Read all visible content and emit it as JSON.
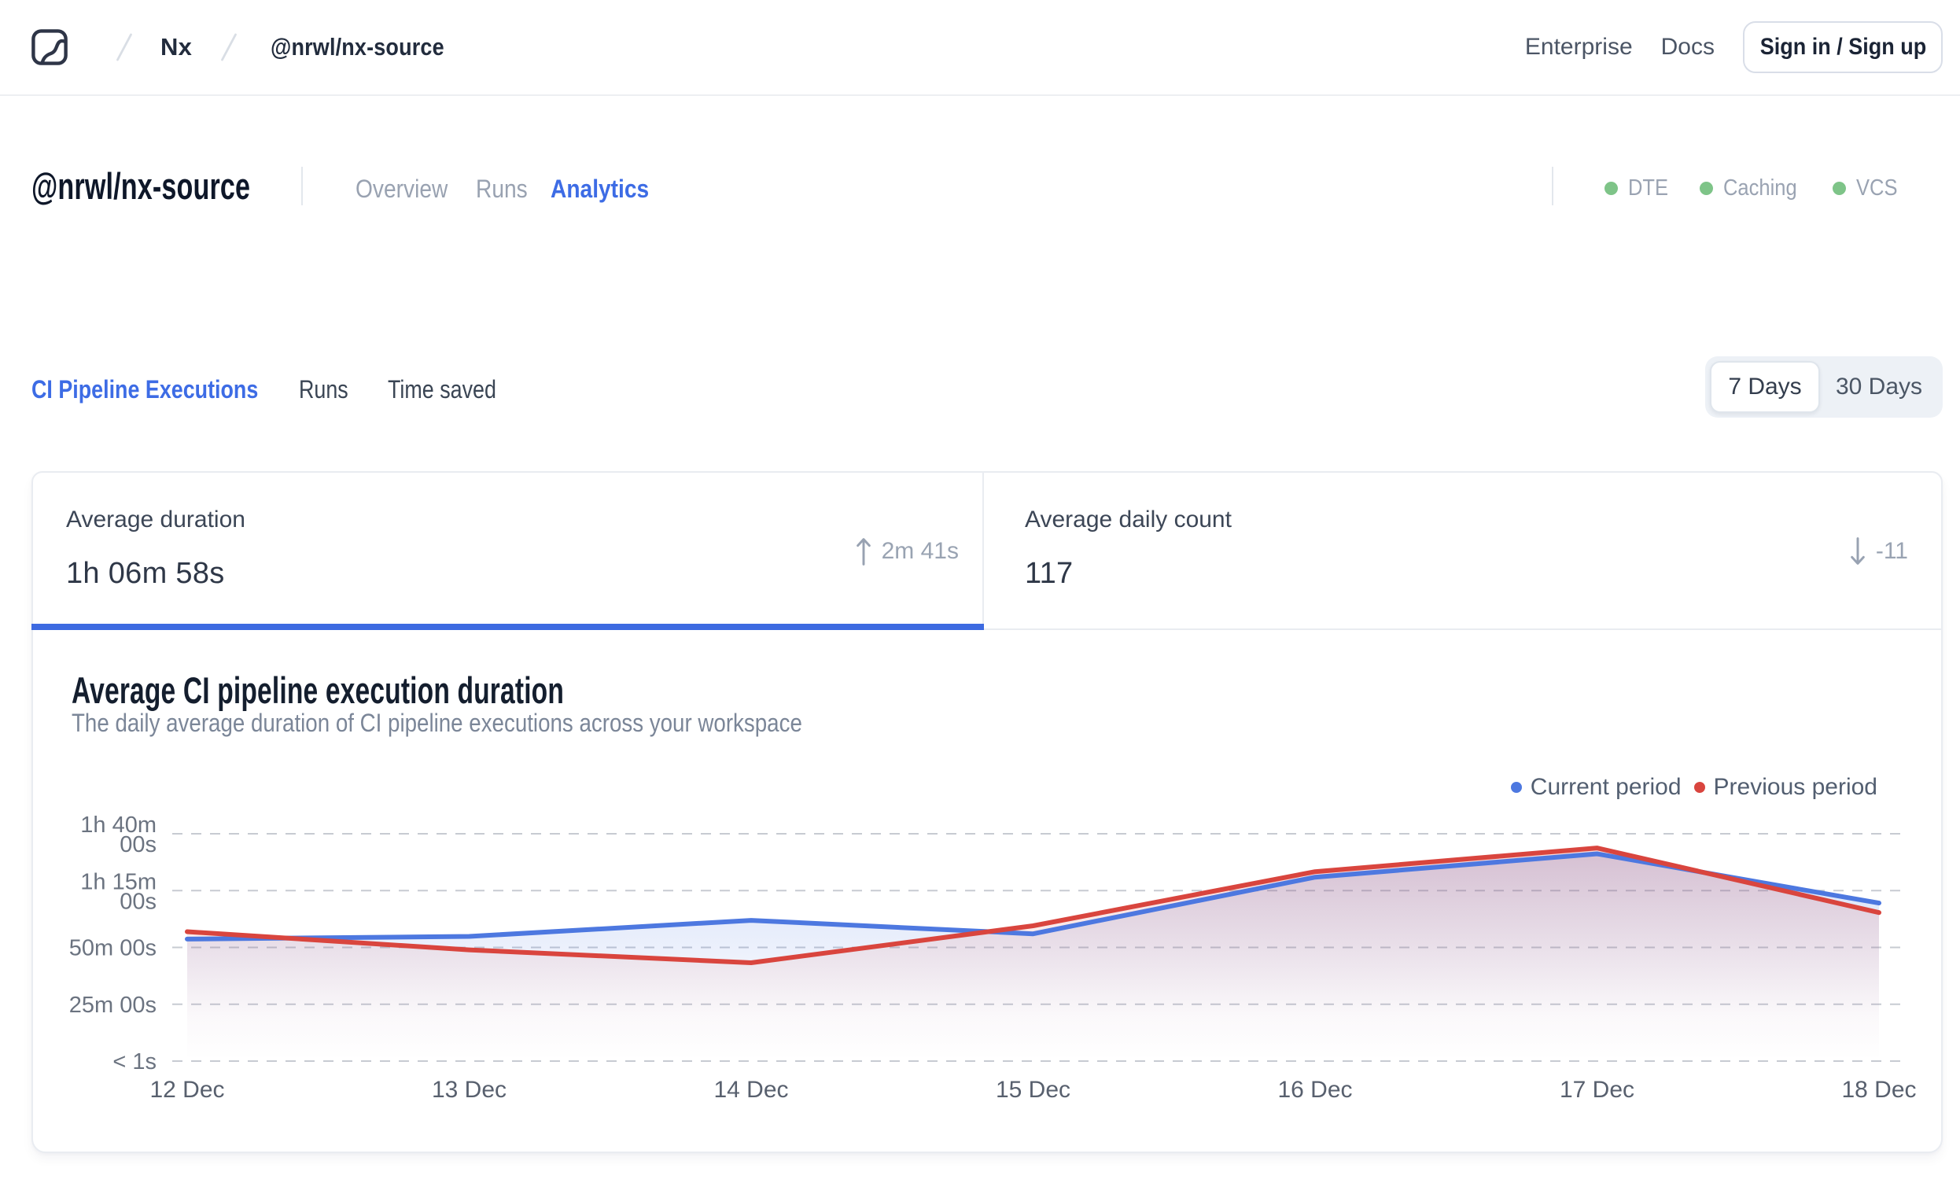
{
  "topbar": {
    "logo": "nx-cloud-logo",
    "breadcrumb": {
      "org": "Nx",
      "workspace": "@nrwl/nx-source"
    },
    "links": {
      "enterprise": "Enterprise",
      "docs": "Docs"
    },
    "signin_label": "Sign in / Sign up"
  },
  "workspace_header": {
    "title": "@nrwl/nx-source",
    "tabs": {
      "overview": "Overview",
      "runs": "Runs",
      "analytics": "Analytics"
    },
    "active_tab": "Analytics",
    "statuses": {
      "dte": "DTE",
      "caching": "Caching",
      "vcs": "VCS"
    },
    "status_dot_color": "#7ec488"
  },
  "analytics_nav": {
    "tabs": {
      "ci": "CI Pipeline Executions",
      "runs": "Runs",
      "time_saved": "Time saved"
    },
    "active_tab": "CI Pipeline Executions",
    "range_toggle": {
      "option_7": "7 Days",
      "option_30": "30 Days",
      "selected": "7 Days"
    }
  },
  "stats": {
    "duration": {
      "label": "Average duration",
      "value": "1h 06m 58s",
      "trend_direction": "up",
      "trend_value": "2m 41s",
      "active": true
    },
    "daily_count": {
      "label": "Average daily count",
      "value": "117",
      "trend_direction": "down",
      "trend_value": "-11",
      "active": false
    }
  },
  "chart_data": {
    "type": "area",
    "title": "Average CI pipeline execution duration",
    "subtitle": "The daily average duration of CI pipeline executions across your workspace",
    "categories": [
      "12 Dec",
      "13 Dec",
      "14 Dec",
      "15 Dec",
      "16 Dec",
      "17 Dec",
      "18 Dec"
    ],
    "series": [
      {
        "name": "Current period",
        "color": "#4d78e0",
        "values_seconds": [
          3220,
          3290,
          3715,
          3360,
          4855,
          5470,
          4170
        ]
      },
      {
        "name": "Previous period",
        "color": "#d9453e",
        "values_seconds": [
          3415,
          2935,
          2595,
          3570,
          5000,
          5625,
          3920
        ]
      }
    ],
    "y_ticks": [
      {
        "seconds": 6000,
        "label_lines": [
          "1h 40m",
          "00s"
        ]
      },
      {
        "seconds": 4500,
        "label_lines": [
          "1h 15m",
          "00s"
        ]
      },
      {
        "seconds": 3000,
        "label_lines": [
          "50m 00s"
        ]
      },
      {
        "seconds": 1500,
        "label_lines": [
          "25m 00s"
        ]
      },
      {
        "seconds": 0,
        "label_lines": [
          "< 1s"
        ]
      }
    ],
    "ylim_seconds": [
      0,
      6000
    ],
    "grid": "horizontal-dashed",
    "legend_position": "top-right",
    "legend": [
      "Current period",
      "Previous period"
    ]
  }
}
